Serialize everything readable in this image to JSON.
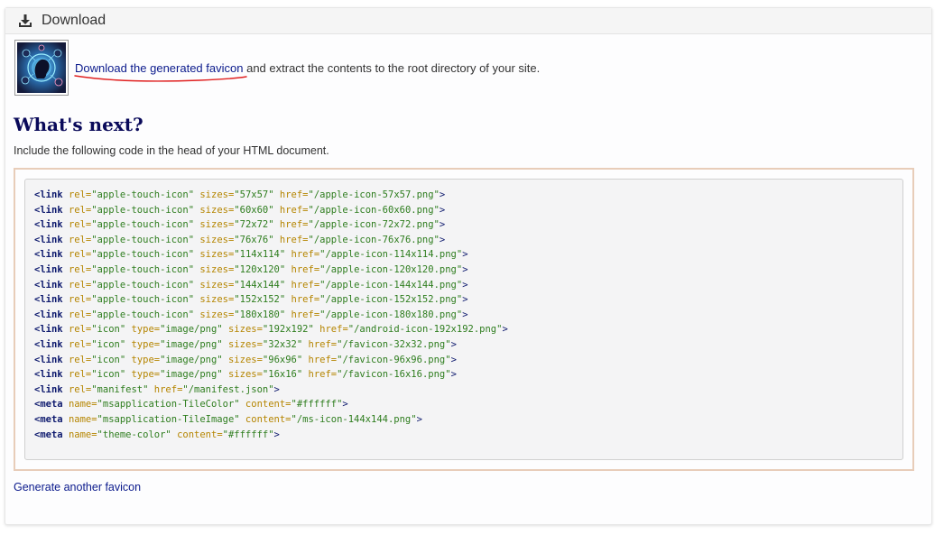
{
  "header": {
    "title": "Download"
  },
  "download_row": {
    "link_text": "Download the generated favicon",
    "rest_text": " and extract the contents to the root directory of your site."
  },
  "next": {
    "heading": "What's next?",
    "intro": "Include the following code in the head of your HTML document."
  },
  "code_lines": [
    {
      "tag": "link",
      "attrs": [
        [
          "rel",
          "apple-touch-icon"
        ],
        [
          "sizes",
          "57x57"
        ],
        [
          "href",
          "/apple-icon-57x57.png"
        ]
      ]
    },
    {
      "tag": "link",
      "attrs": [
        [
          "rel",
          "apple-touch-icon"
        ],
        [
          "sizes",
          "60x60"
        ],
        [
          "href",
          "/apple-icon-60x60.png"
        ]
      ]
    },
    {
      "tag": "link",
      "attrs": [
        [
          "rel",
          "apple-touch-icon"
        ],
        [
          "sizes",
          "72x72"
        ],
        [
          "href",
          "/apple-icon-72x72.png"
        ]
      ]
    },
    {
      "tag": "link",
      "attrs": [
        [
          "rel",
          "apple-touch-icon"
        ],
        [
          "sizes",
          "76x76"
        ],
        [
          "href",
          "/apple-icon-76x76.png"
        ]
      ]
    },
    {
      "tag": "link",
      "attrs": [
        [
          "rel",
          "apple-touch-icon"
        ],
        [
          "sizes",
          "114x114"
        ],
        [
          "href",
          "/apple-icon-114x114.png"
        ]
      ]
    },
    {
      "tag": "link",
      "attrs": [
        [
          "rel",
          "apple-touch-icon"
        ],
        [
          "sizes",
          "120x120"
        ],
        [
          "href",
          "/apple-icon-120x120.png"
        ]
      ]
    },
    {
      "tag": "link",
      "attrs": [
        [
          "rel",
          "apple-touch-icon"
        ],
        [
          "sizes",
          "144x144"
        ],
        [
          "href",
          "/apple-icon-144x144.png"
        ]
      ]
    },
    {
      "tag": "link",
      "attrs": [
        [
          "rel",
          "apple-touch-icon"
        ],
        [
          "sizes",
          "152x152"
        ],
        [
          "href",
          "/apple-icon-152x152.png"
        ]
      ]
    },
    {
      "tag": "link",
      "attrs": [
        [
          "rel",
          "apple-touch-icon"
        ],
        [
          "sizes",
          "180x180"
        ],
        [
          "href",
          "/apple-icon-180x180.png"
        ]
      ]
    },
    {
      "tag": "link",
      "attrs": [
        [
          "rel",
          "icon"
        ],
        [
          "type",
          "image/png"
        ],
        [
          "sizes",
          "192x192"
        ],
        [
          "href",
          "/android-icon-192x192.png"
        ]
      ]
    },
    {
      "tag": "link",
      "attrs": [
        [
          "rel",
          "icon"
        ],
        [
          "type",
          "image/png"
        ],
        [
          "sizes",
          "32x32"
        ],
        [
          "href",
          "/favicon-32x32.png"
        ]
      ]
    },
    {
      "tag": "link",
      "attrs": [
        [
          "rel",
          "icon"
        ],
        [
          "type",
          "image/png"
        ],
        [
          "sizes",
          "96x96"
        ],
        [
          "href",
          "/favicon-96x96.png"
        ]
      ]
    },
    {
      "tag": "link",
      "attrs": [
        [
          "rel",
          "icon"
        ],
        [
          "type",
          "image/png"
        ],
        [
          "sizes",
          "16x16"
        ],
        [
          "href",
          "/favicon-16x16.png"
        ]
      ]
    },
    {
      "tag": "link",
      "attrs": [
        [
          "rel",
          "manifest"
        ],
        [
          "href",
          "/manifest.json"
        ]
      ]
    },
    {
      "tag": "meta",
      "attrs": [
        [
          "name",
          "msapplication-TileColor"
        ],
        [
          "content",
          "#ffffff"
        ]
      ]
    },
    {
      "tag": "meta",
      "attrs": [
        [
          "name",
          "msapplication-TileImage"
        ],
        [
          "content",
          "/ms-icon-144x144.png"
        ]
      ]
    },
    {
      "tag": "meta",
      "attrs": [
        [
          "name",
          "theme-color"
        ],
        [
          "content",
          "#ffffff"
        ]
      ]
    }
  ],
  "footer": {
    "link_text": "Generate another favicon"
  },
  "colors": {
    "link": "#0b1a8c",
    "heading": "#0a0a5a",
    "code_tag": "#0e1a6e",
    "code_attr": "#b58500",
    "code_value": "#2e7d1e",
    "annotation_underline": "#e02020",
    "code_border": "#e8cdb9"
  },
  "icons": {
    "header": "download-icon",
    "thumbnail": "favicon-preview-image"
  }
}
